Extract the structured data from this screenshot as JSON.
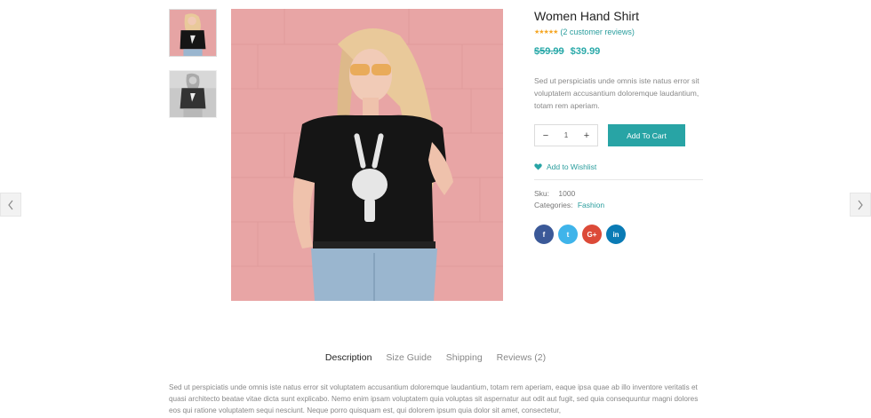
{
  "product": {
    "title": "Women Hand Shirt",
    "rating_stars": "★★★★★",
    "reviews_link": "(2 customer reviews)",
    "price_old": "$59.99",
    "price_new": "$39.99",
    "short_description": "Sed ut perspiciatis unde omnis iste natus error sit voluptatem accusantium doloremque laudantium, totam rem aperiam."
  },
  "cart": {
    "minus": "−",
    "quantity": "1",
    "plus": "+",
    "add_to_cart": "Add To Cart"
  },
  "wishlist": {
    "label": "Add to Wishlist"
  },
  "meta": {
    "sku_label": "Sku:",
    "sku_value": "1000",
    "categories_label": "Categories:",
    "categories_value": "Fashion"
  },
  "social": {
    "facebook": "f",
    "twitter": "t",
    "googleplus": "G+",
    "linkedin": "in"
  },
  "tabs": [
    {
      "label": "Description"
    },
    {
      "label": "Size Guide"
    },
    {
      "label": "Shipping"
    },
    {
      "label": "Reviews (2)"
    }
  ],
  "long_description": "Sed ut perspiciatis unde omnis iste natus error sit voluptatem accusantium doloremque laudantium, totam rem aperiam, eaque ipsa quae ab illo inventore veritatis et quasi architecto beatae vitae dicta sunt explicabo. Nemo enim ipsam voluptatem quia voluptas sit aspernatur aut odit aut fugit, sed quia consequuntur magni dolores eos qui ratione voluptatem sequi nesciunt. Neque porro quisquam est, qui dolorem ipsum quia dolor sit amet, consectetur,",
  "colors": {
    "accent": "#28a4a5",
    "star": "#f5a623",
    "background_wall": "#e8a5a5",
    "shirt": "#151515"
  }
}
